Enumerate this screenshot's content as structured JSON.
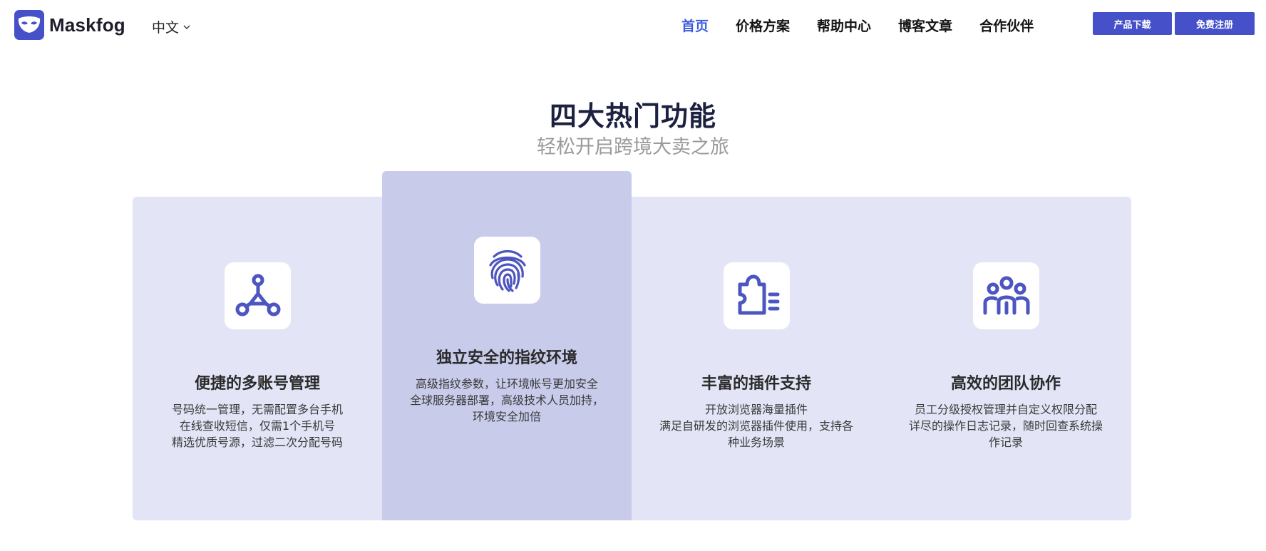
{
  "header": {
    "brand": "Maskfog",
    "language": "中文",
    "nav": [
      {
        "label": "首页",
        "active": true
      },
      {
        "label": "价格方案",
        "active": false
      },
      {
        "label": "帮助中心",
        "active": false
      },
      {
        "label": "博客文章",
        "active": false
      },
      {
        "label": "合作伙伴",
        "active": false
      }
    ],
    "download_label": "产品下载",
    "register_label": "免费注册"
  },
  "section": {
    "title": "四大热门功能",
    "subtitle": "轻松开启跨境大卖之旅"
  },
  "features": [
    {
      "icon": "network-nodes-icon",
      "title": "便捷的多账号管理",
      "lines": [
        "号码统一管理，无需配置多台手机",
        "在线查收短信，仅需1个手机号",
        "精选优质号源，过滤二次分配号码"
      ]
    },
    {
      "icon": "fingerprint-icon",
      "title": "独立安全的指纹环境",
      "lines": [
        "高级指纹参数，让环境帐号更加安全",
        "全球服务器部署，高级技术人员加持，",
        "环境安全加倍"
      ]
    },
    {
      "icon": "puzzle-plugin-icon",
      "title": "丰富的插件支持",
      "lines": [
        "开放浏览器海量插件",
        "满足自研发的浏览器插件使用，支持各",
        "种业务场景"
      ]
    },
    {
      "icon": "team-users-icon",
      "title": "高效的团队协作",
      "lines": [
        "员工分级授权管理并自定义权限分配",
        "详尽的操作日志记录，随时回查系统操",
        "作记录"
      ]
    }
  ],
  "colors": {
    "accent": "#4651c9",
    "nav_active": "#3b5bdb",
    "card_bg": "#e3e5f7",
    "card_highlight": "#c8cbea",
    "icon_color": "#4c55c0"
  }
}
